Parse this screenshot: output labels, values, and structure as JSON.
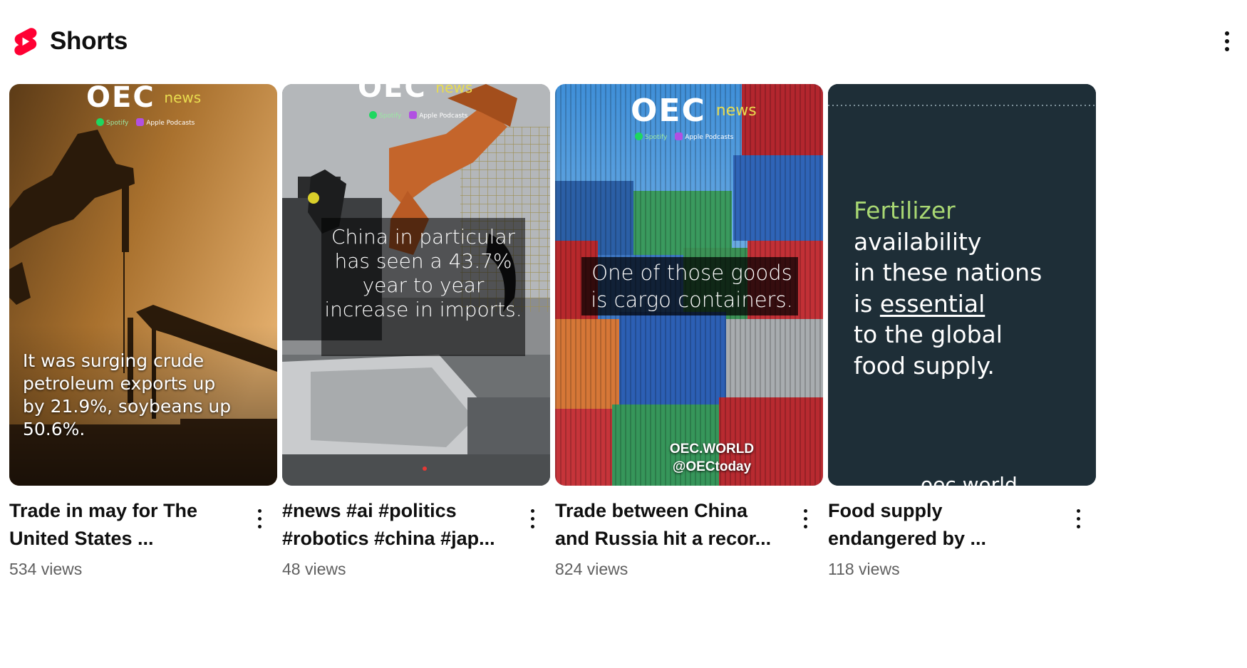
{
  "shelf": {
    "title": "Shorts",
    "logo_icon": "shorts-logo-icon",
    "menu_icon": "more-vertical-icon",
    "brand_color": "#ff0033"
  },
  "shorts": [
    {
      "title": "Trade in may for The United States ...",
      "views": "534 views",
      "thumb": {
        "brand": "OEC",
        "brand_suffix": "news",
        "spotify": "Spotify",
        "apple": "Apple Podcasts",
        "caption": "It was surging crude petroleum exports up by 21.9%, soybeans up 50.6%."
      }
    },
    {
      "title": "#news #ai #politics #robotics #china #jap...",
      "views": "48 views",
      "thumb": {
        "brand": "OEC",
        "brand_suffix": "news",
        "spotify": "Spotify",
        "apple": "Apple Podcasts",
        "caption": "China in particular has seen a 43.7% year to year increase in imports."
      }
    },
    {
      "title": "Trade between China and Russia hit a recor...",
      "views": "824 views",
      "thumb": {
        "brand": "OEC",
        "brand_suffix": "news",
        "spotify": "Spotify",
        "apple": "Apple Podcasts",
        "caption": "One of those goods is cargo containers.",
        "watermark_line1": "OEC.WORLD",
        "watermark_line2": "@OECtoday"
      }
    },
    {
      "title": "Food supply endangered by ...",
      "views": "118 views",
      "thumb": {
        "caption_word1": "Fertilizer",
        "caption_rest1": " availability",
        "caption_line2": "in these nations",
        "caption_is": "is ",
        "caption_essential": "essential",
        "caption_line4": "to the global",
        "caption_line5": "food supply.",
        "footer": "oec.world"
      }
    }
  ]
}
